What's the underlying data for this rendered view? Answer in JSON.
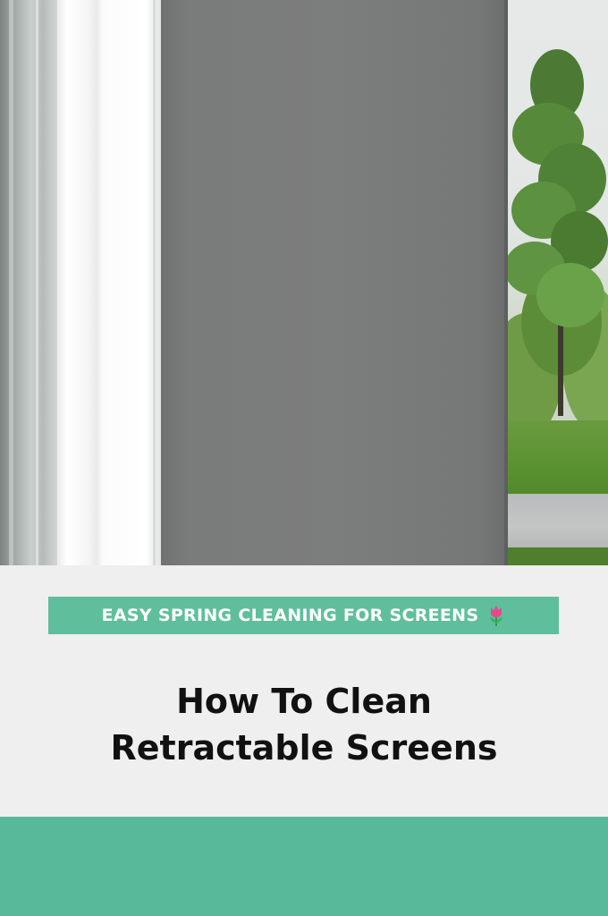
{
  "banner": {
    "text": "EASY SPRING CLEANING FOR SCREENS",
    "icon": "tulip-icon",
    "background": "#5fbf9d",
    "text_color": "#ffffff"
  },
  "title": {
    "line1": "How To Clean",
    "line2": "Retractable Screens",
    "color": "#111111"
  },
  "colors": {
    "page_background": "#efefef",
    "footer_band": "#57b99a",
    "screen_panel": "#7c7d7d"
  }
}
